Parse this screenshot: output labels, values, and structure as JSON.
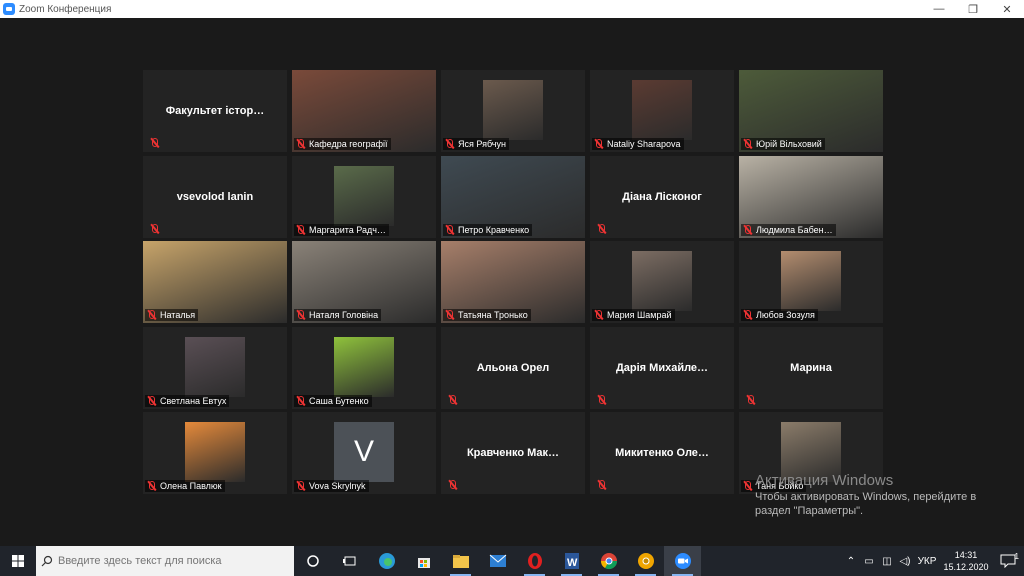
{
  "window": {
    "title": "Zoom Конференция",
    "controls": {
      "minimize": "—",
      "maximize": "❐",
      "close": "✕"
    }
  },
  "participants": [
    {
      "display": "Факультет істор…",
      "label": "",
      "has_video": false
    },
    {
      "display": "",
      "label": "Кафедра географії",
      "has_video": true,
      "bg": "#7a4a3a"
    },
    {
      "display": "",
      "label": "Яся Рябчун",
      "has_video": true,
      "bg": "#6b5a4d"
    },
    {
      "display": "",
      "label": "Nataliy Sharapova",
      "has_video": true,
      "bg": "#5b3b32"
    },
    {
      "display": "",
      "label": "Юрій Вільховий",
      "has_video": true,
      "bg": "#4d5b3a"
    },
    {
      "display": "vsevolod lanin",
      "label": "",
      "has_video": false
    },
    {
      "display": "",
      "label": "Маргарита Радч…",
      "has_video": true,
      "bg": "#5a6b4a"
    },
    {
      "display": "",
      "label": "Петро Кравченко",
      "has_video": true,
      "bg": "#3f4a52",
      "active": true
    },
    {
      "display": "Діана Лісконог",
      "label": "",
      "has_video": false
    },
    {
      "display": "",
      "label": "Людмила Бабен…",
      "has_video": true,
      "bg": "#b9b2a5"
    },
    {
      "display": "",
      "label": "Наталья",
      "has_video": true,
      "bg": "#c7a46a"
    },
    {
      "display": "",
      "label": "Наталя Головіна",
      "has_video": true,
      "bg": "#8a8278"
    },
    {
      "display": "",
      "label": "Татьяна Тронько",
      "has_video": true,
      "bg": "#a77f6a"
    },
    {
      "display": "",
      "label": "Мария Шамрай",
      "has_video": true,
      "bg": "#7c6d63"
    },
    {
      "display": "",
      "label": "Любов Зозуля",
      "has_video": true,
      "bg": "#b38d6f"
    },
    {
      "display": "",
      "label": "Светлана Евтух",
      "has_video": true,
      "bg": "#5a4f55"
    },
    {
      "display": "",
      "label": "Саша Бутенко",
      "has_video": true,
      "bg": "#8fc23c"
    },
    {
      "display": "Альона Орел",
      "label": "",
      "has_video": false
    },
    {
      "display": "Дарія  Михайле…",
      "label": "",
      "has_video": false
    },
    {
      "display": "Марина",
      "label": "",
      "has_video": false
    },
    {
      "display": "",
      "label": "Олена Павлюк",
      "has_video": true,
      "bg": "#e58a3b"
    },
    {
      "display": "",
      "label": "Vova Skrylnyk",
      "has_video": false,
      "avatar": "V"
    },
    {
      "display": "Кравченко  Мак…",
      "label": "",
      "has_video": false
    },
    {
      "display": "Микитенко  Оле…",
      "label": "",
      "has_video": false
    },
    {
      "display": "",
      "label": "Таня Бойко",
      "has_video": true,
      "bg": "#8b7c6a"
    }
  ],
  "watermark": {
    "title": "Активация Windows",
    "line1": "Чтобы активировать Windows, перейдите в",
    "line2": "раздел \"Параметры\"."
  },
  "taskbar": {
    "search_placeholder": "Введите здесь текст для поиска",
    "apps": [
      "task-view-icon",
      "edge-icon",
      "store-icon",
      "file-explorer-icon",
      "mail-icon",
      "opera-icon",
      "word-icon",
      "chrome-icon",
      "chrome-canary-icon",
      "zoom-icon"
    ],
    "lang": "УКР",
    "time": "14:31",
    "date": "15.12.2020",
    "notifications": "1"
  }
}
